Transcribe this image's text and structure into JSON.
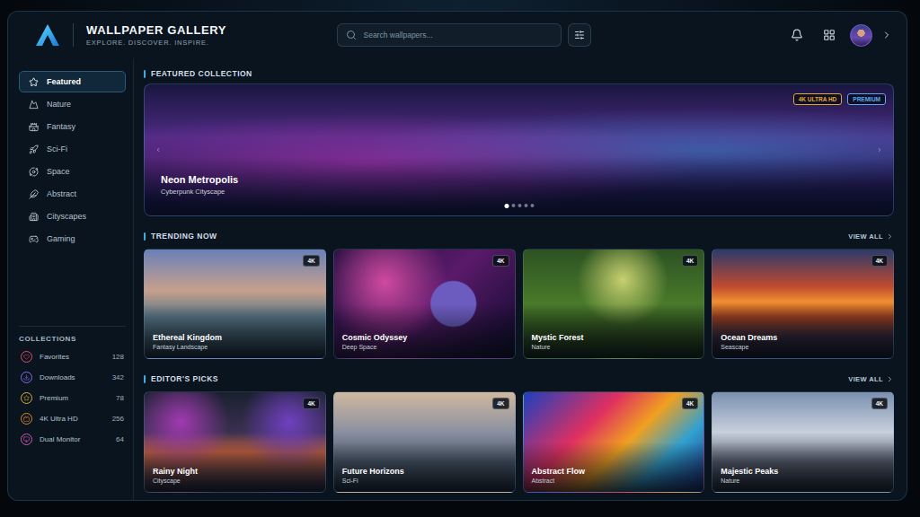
{
  "app": {
    "title": "WALLPAPER GALLERY",
    "tagline": "EXPLORE. DISCOVER. INSPIRE."
  },
  "search": {
    "placeholder": "Search wallpapers..."
  },
  "sidebar": {
    "items": [
      {
        "label": "Featured",
        "selected": true
      },
      {
        "label": "Nature",
        "selected": false
      },
      {
        "label": "Fantasy",
        "selected": false
      },
      {
        "label": "Sci-Fi",
        "selected": false
      },
      {
        "label": "Space",
        "selected": false
      },
      {
        "label": "Abstract",
        "selected": false
      },
      {
        "label": "Cityscapes",
        "selected": false
      },
      {
        "label": "Gaming",
        "selected": false
      }
    ],
    "collections_title": "COLLECTIONS",
    "collections": [
      {
        "label": "Favorites",
        "count": "128",
        "color": "#e0506a"
      },
      {
        "label": "Downloads",
        "count": "342",
        "color": "#8a6cf0"
      },
      {
        "label": "Premium",
        "count": "78",
        "color": "#e0b030"
      },
      {
        "label": "4K Ultra HD",
        "count": "256",
        "color": "#e08a30"
      },
      {
        "label": "Dual Monitor",
        "count": "64",
        "color": "#d05ab0"
      }
    ]
  },
  "featured": {
    "title": "FEATURED COLLECTION",
    "name": "Neon Metropolis",
    "subtitle": "Cyberpunk Cityscape",
    "badges": [
      {
        "label": "4K ULTRA HD",
        "color": "#e0a830"
      },
      {
        "label": "PREMIUM",
        "color": "#5aa8f0"
      }
    ],
    "slides": [
      {
        "selected": true
      },
      {
        "selected": false
      },
      {
        "selected": false
      },
      {
        "selected": false
      },
      {
        "selected": false
      }
    ]
  },
  "sections": [
    {
      "title": "TRENDING NOW",
      "action": "VIEW ALL",
      "cards": [
        {
          "title": "Ethereal Kingdom",
          "category": "Fantasy Landscape",
          "badge": "4K"
        },
        {
          "title": "Cosmic Odyssey",
          "category": "Deep Space",
          "badge": "4K"
        },
        {
          "title": "Mystic Forest",
          "category": "Nature",
          "badge": "4K"
        },
        {
          "title": "Ocean Dreams",
          "category": "Seascape",
          "badge": "4K"
        }
      ]
    },
    {
      "title": "EDITOR'S PICKS",
      "action": "VIEW ALL",
      "cards": [
        {
          "title": "Rainy Night",
          "category": "Cityscape",
          "badge": "4K"
        },
        {
          "title": "Future Horizons",
          "category": "Sci-Fi",
          "badge": "4K"
        },
        {
          "title": "Abstract Flow",
          "category": "Abstract",
          "badge": "4K"
        },
        {
          "title": "Majestic Peaks",
          "category": "Nature",
          "badge": "4K"
        }
      ]
    }
  ]
}
